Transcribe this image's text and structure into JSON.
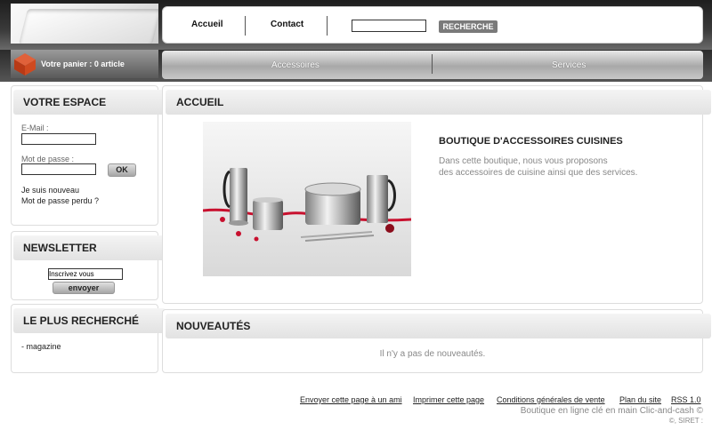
{
  "header": {
    "nav": [
      {
        "label": "Accueil"
      },
      {
        "label": "Contact"
      }
    ],
    "search": {
      "placeholder": "",
      "button_label": "RECHERCHE"
    }
  },
  "cart": {
    "label": "Votre panier : 0 article"
  },
  "menu": [
    {
      "label": "Accessoires"
    },
    {
      "label": "Services"
    }
  ],
  "sidebar": {
    "account": {
      "title": "VOTRE ESPACE",
      "email_label": "E-Mail :",
      "password_label": "Mot de passe :",
      "ok_label": "OK",
      "new_user": "Je suis nouveau",
      "lost_password": "Mot de passe perdu ?"
    },
    "newsletter": {
      "title": "NEWSLETTER",
      "input_value": "Inscrivez vous",
      "button_label": "envoyer"
    },
    "popular": {
      "title": "LE PLUS RECHERCHÉ",
      "items": [
        "- magazine"
      ]
    }
  },
  "main": {
    "home": {
      "title": "ACCUEIL",
      "heading": "BOUTIQUE D'ACCESSOIRES CUISINES",
      "text_line1": "Dans cette boutique, nous vous proposons",
      "text_line2": "des accessoires de cuisine ainsi que des services."
    },
    "news": {
      "title": "NOUVEAUTÉS",
      "empty_text": "Il n'y a pas de nouveautés."
    }
  },
  "footer": {
    "links": [
      {
        "label": "Envoyer cette page à un ami"
      },
      {
        "label": "Imprimer cette page"
      },
      {
        "label": "Conditions générales de vente"
      },
      {
        "label": "Plan du site"
      },
      {
        "label": "RSS 1.0"
      }
    ],
    "credit": "Boutique en ligne clé en main Clic-and-cash ©",
    "siret": "©, SIRET :"
  },
  "colors": {
    "accent_orange": "#d0451b",
    "text_gray": "#888888"
  }
}
